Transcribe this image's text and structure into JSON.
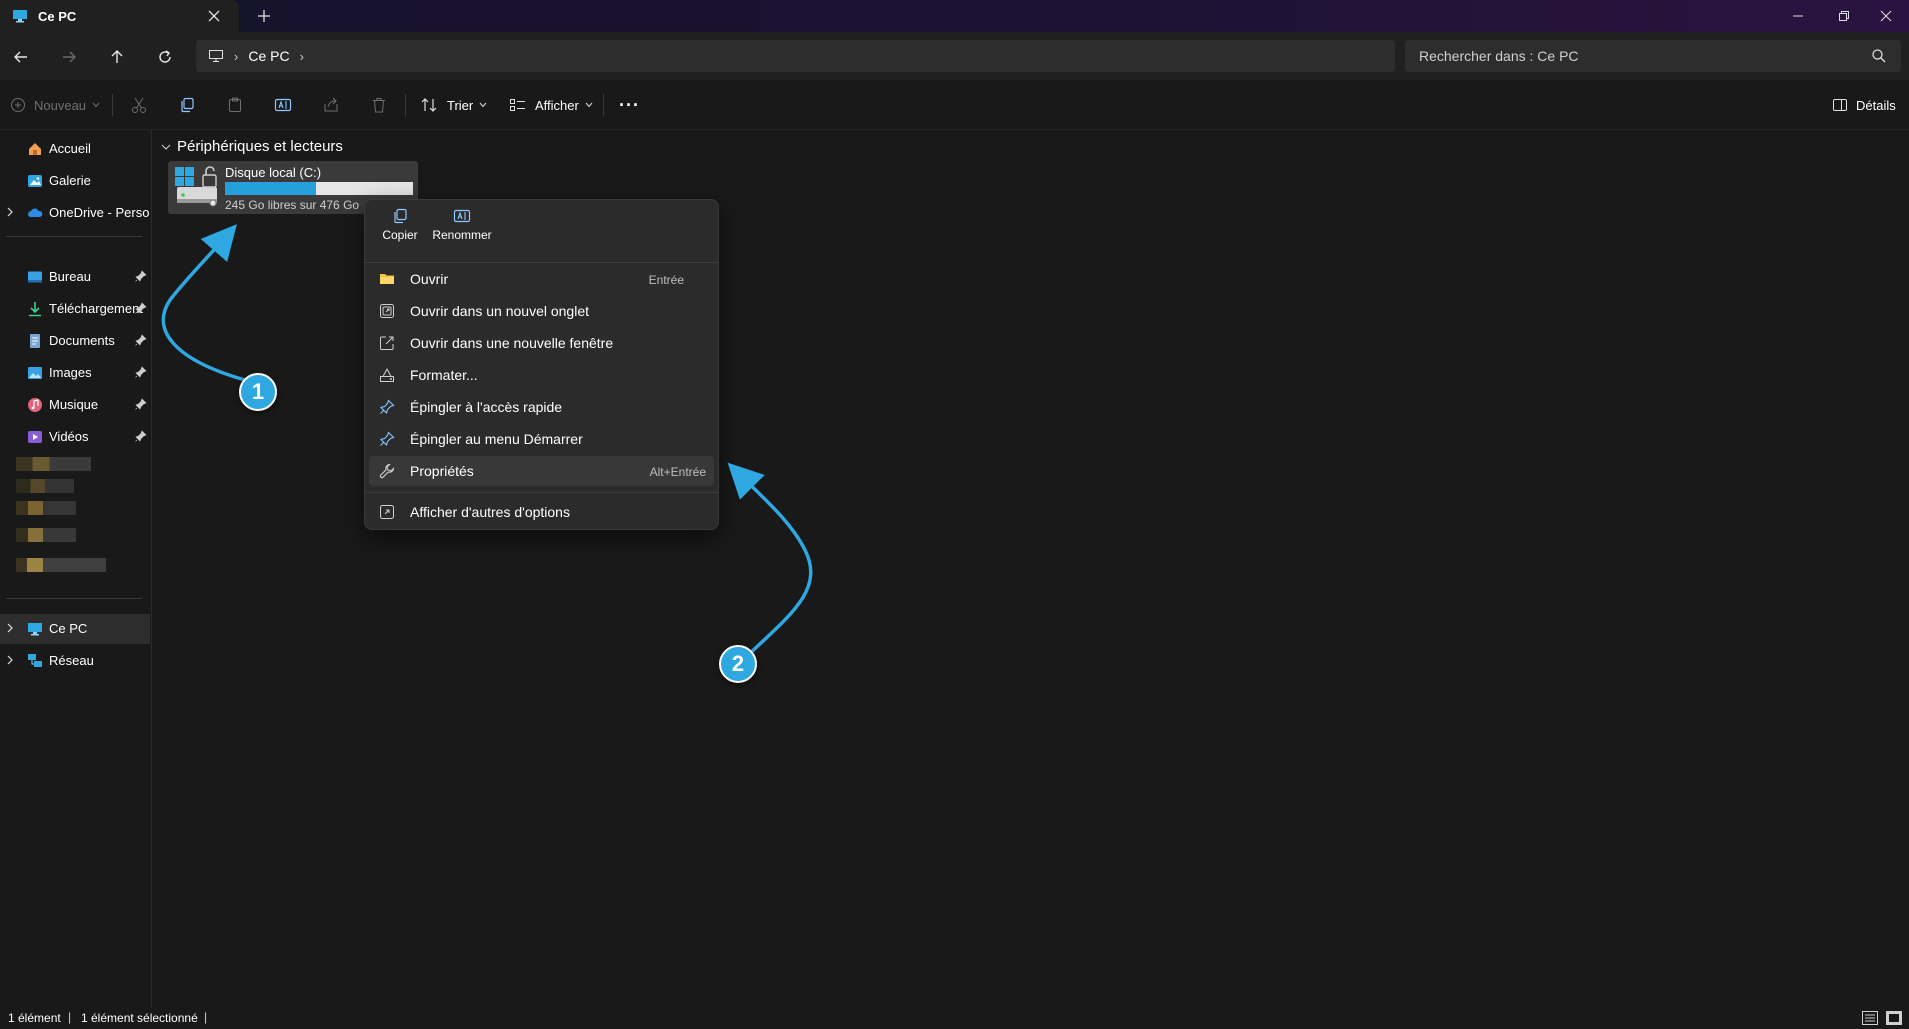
{
  "window": {
    "tab_title": "Ce PC",
    "new_tab": "+"
  },
  "address": {
    "crumbs": [
      "Ce PC"
    ],
    "search_placeholder": "Rechercher dans : Ce PC"
  },
  "toolbar": {
    "new_label": "Nouveau",
    "sort_label": "Trier",
    "view_label": "Afficher",
    "more_label": "···",
    "details_label": "Détails"
  },
  "sidebar": {
    "top_items": [
      {
        "label": "Accueil",
        "icon": "home-icon"
      },
      {
        "label": "Galerie",
        "icon": "gallery-icon"
      },
      {
        "label": "OneDrive - Persona",
        "icon": "onedrive-icon"
      }
    ],
    "quick_access": [
      {
        "label": "Bureau",
        "icon": "desktop-folder-icon"
      },
      {
        "label": "Téléchargement",
        "icon": "downloads-icon"
      },
      {
        "label": "Documents",
        "icon": "documents-icon"
      },
      {
        "label": "Images",
        "icon": "pictures-icon"
      },
      {
        "label": "Musique",
        "icon": "music-icon"
      },
      {
        "label": "Vidéos",
        "icon": "videos-icon"
      }
    ],
    "bottom_items": [
      {
        "label": "Ce PC",
        "icon": "pc-icon",
        "selected": true
      },
      {
        "label": "Réseau",
        "icon": "network-icon"
      }
    ]
  },
  "content": {
    "group_title": "Périphériques et lecteurs",
    "drive": {
      "name": "Disque local (C:)",
      "free_text": "245 Go libres sur 476 Go",
      "used_fraction": 0.485,
      "bar_color": "#26a0da"
    }
  },
  "context_menu": {
    "top_actions": [
      {
        "label": "Copier",
        "icon": "copy-icon"
      },
      {
        "label": "Renommer",
        "icon": "rename-icon"
      }
    ],
    "items": [
      {
        "label": "Ouvrir",
        "shortcut": "Entrée",
        "icon": "folder-icon"
      },
      {
        "label": "Ouvrir dans un nouvel onglet",
        "shortcut": "",
        "icon": "new-tab-icon"
      },
      {
        "label": "Ouvrir dans une nouvelle fenêtre",
        "shortcut": "",
        "icon": "new-window-icon"
      },
      {
        "label": "Formater...",
        "shortcut": "",
        "icon": "format-icon"
      },
      {
        "label": "Épingler à l'accès rapide",
        "shortcut": "",
        "icon": "pin-icon"
      },
      {
        "label": "Épingler au menu Démarrer",
        "shortcut": "",
        "icon": "pin-start-icon"
      },
      {
        "label": "Propriétés",
        "shortcut": "Alt+Entrée",
        "icon": "wrench-icon"
      },
      {
        "label": "Afficher d'autres d'options",
        "shortcut": "",
        "icon": "more-options-icon"
      }
    ]
  },
  "status": {
    "count": "1 élément",
    "selected": "1 élément sélectionné"
  },
  "annotations": {
    "badge_1": "1",
    "badge_2": "2",
    "accent_color": "#2fa8e2"
  }
}
